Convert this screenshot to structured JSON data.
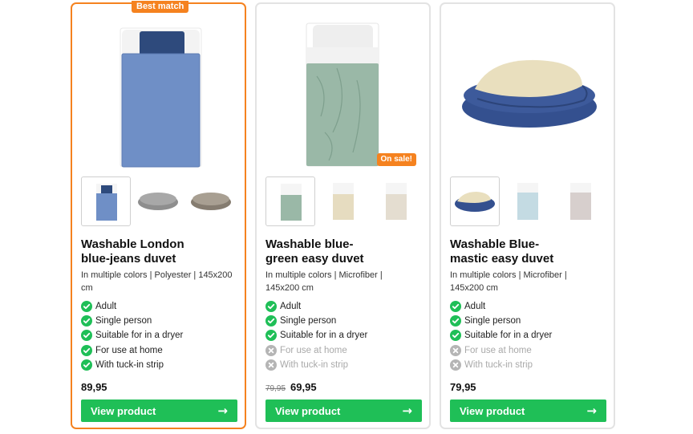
{
  "best_match_label": "Best match",
  "sale_label": "On sale!",
  "check_icon": "check-circle-icon",
  "cross_icon": "x-circle-icon",
  "colors": {
    "accent": "#f5821f",
    "button": "#1fbf57",
    "check": "#1fbf57",
    "cross": "#b5b5b5"
  },
  "products": [
    {
      "title_line1": "Washable London",
      "title_line2": "blue-jeans duvet",
      "subtitle_line1": "In multiple colors | Polyester | 145x200",
      "subtitle_line2": "cm",
      "features": [
        {
          "label": "Adult",
          "available": true
        },
        {
          "label": "Single person",
          "available": true
        },
        {
          "label": "Suitable for in a dryer",
          "available": true
        },
        {
          "label": "For use at home",
          "available": true
        },
        {
          "label": "With tuck-in strip",
          "available": true
        }
      ],
      "old_price": "",
      "price": "89,95",
      "button_label": "View product",
      "button_arrow": "→"
    },
    {
      "title_line1": "Washable blue-",
      "title_line2": "green easy duvet",
      "subtitle_line1": "In multiple colors | Microfiber |",
      "subtitle_line2": "145x200 cm",
      "features": [
        {
          "label": "Adult",
          "available": true
        },
        {
          "label": "Single person",
          "available": true
        },
        {
          "label": "Suitable for in a dryer",
          "available": true
        },
        {
          "label": "For use at home",
          "available": false
        },
        {
          "label": "With tuck-in strip",
          "available": false
        }
      ],
      "old_price": "79,95",
      "price": "69,95",
      "button_label": "View product",
      "button_arrow": "→"
    },
    {
      "title_line1": "Washable Blue-",
      "title_line2": "mastic easy duvet",
      "subtitle_line1": "In multiple colors | Microfiber |",
      "subtitle_line2": "145x200 cm",
      "features": [
        {
          "label": "Adult",
          "available": true
        },
        {
          "label": "Single person",
          "available": true
        },
        {
          "label": "Suitable for in a dryer",
          "available": true
        },
        {
          "label": "For use at home",
          "available": false
        },
        {
          "label": "With tuck-in strip",
          "available": false
        }
      ],
      "old_price": "",
      "price": "79,95",
      "button_label": "View product",
      "button_arrow": "→"
    }
  ]
}
